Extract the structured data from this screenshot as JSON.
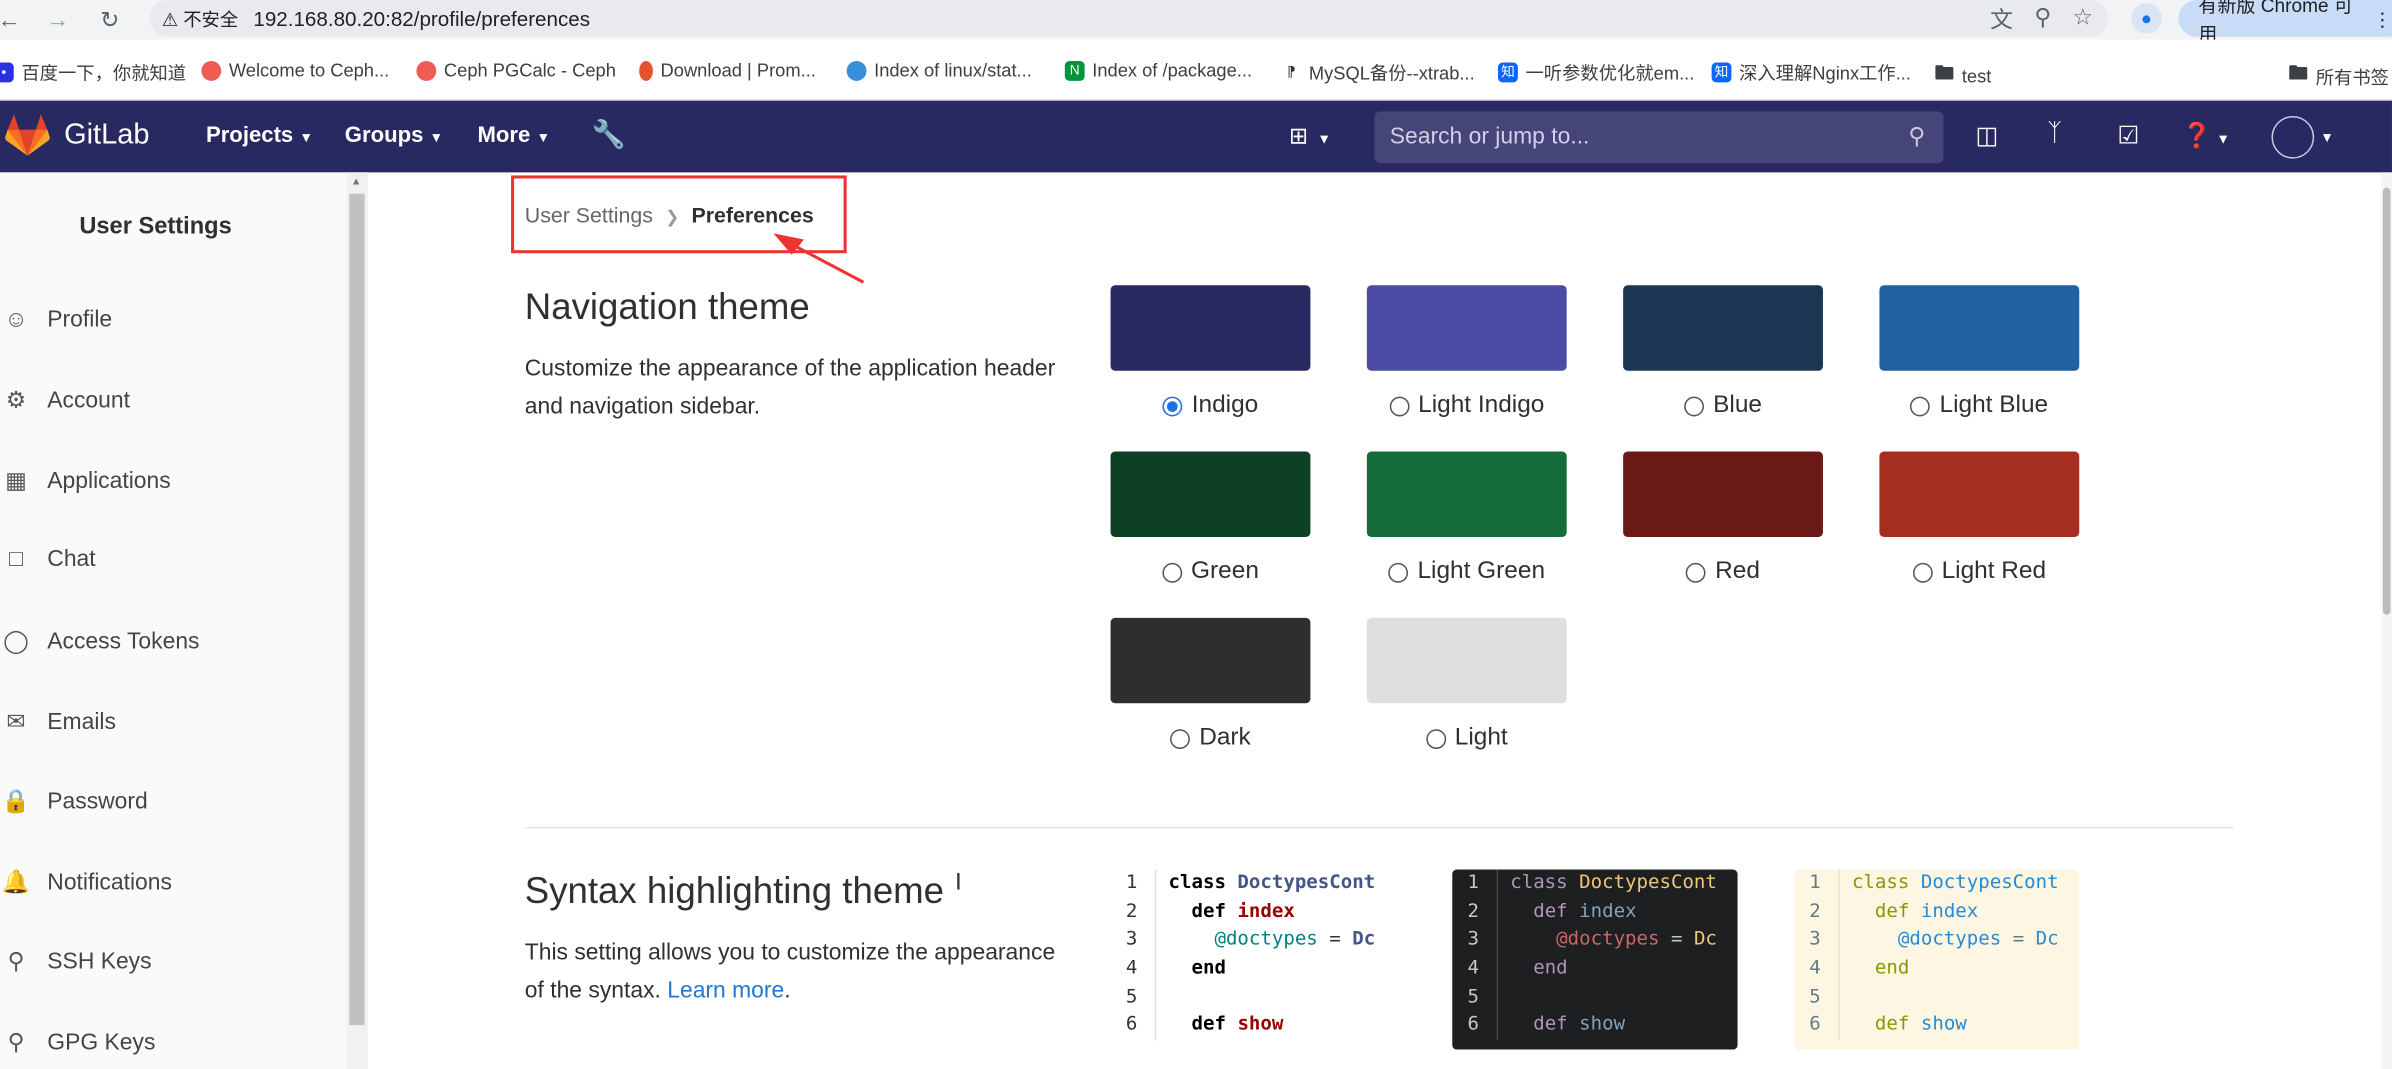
{
  "browser": {
    "warning": "不安全",
    "url": "192.168.80.20:82/profile/preferences",
    "update_label": "有新版 Chrome 可用",
    "bookmarks": [
      {
        "label": "百度一下，你就知道"
      },
      {
        "label": "Welcome to Ceph..."
      },
      {
        "label": "Ceph PGCalc - Ceph"
      },
      {
        "label": "Download | Prom..."
      },
      {
        "label": "Index of linux/stat..."
      },
      {
        "label": "Index of /package..."
      },
      {
        "label": "MySQL备份--xtrab..."
      },
      {
        "label": "一听参数优化就em..."
      },
      {
        "label": "深入理解Nginx工作..."
      },
      {
        "label": "test"
      }
    ],
    "all_bookmarks": "所有书签"
  },
  "header": {
    "brand": "GitLab",
    "menus": [
      "Projects",
      "Groups",
      "More"
    ],
    "search_placeholder": "Search or jump to..."
  },
  "sidebar": {
    "title": "User Settings",
    "items": [
      {
        "label": "Profile",
        "icon": "user-circle-icon"
      },
      {
        "label": "Account",
        "icon": "account-gear-icon"
      },
      {
        "label": "Applications",
        "icon": "applications-grid-icon"
      },
      {
        "label": "Chat",
        "icon": "chat-bubble-icon"
      },
      {
        "label": "Access Tokens",
        "icon": "token-icon"
      },
      {
        "label": "Emails",
        "icon": "envelope-icon"
      },
      {
        "label": "Password",
        "icon": "lock-icon"
      },
      {
        "label": "Notifications",
        "icon": "bell-icon"
      },
      {
        "label": "SSH Keys",
        "icon": "key-icon"
      },
      {
        "label": "GPG Keys",
        "icon": "key-icon"
      }
    ]
  },
  "breadcrumb": {
    "parent": "User Settings",
    "current": "Preferences"
  },
  "nav_theme": {
    "title": "Navigation theme",
    "description": "Customize the appearance of the application header and navigation sidebar.",
    "themes": [
      {
        "name": "Indigo",
        "color": "#292961",
        "selected": true
      },
      {
        "name": "Light Indigo",
        "color": "#4b4ba3",
        "selected": false
      },
      {
        "name": "Blue",
        "color": "#1a3652",
        "selected": false
      },
      {
        "name": "Light Blue",
        "color": "#2261a1",
        "selected": false
      },
      {
        "name": "Green",
        "color": "#0d4024",
        "selected": false
      },
      {
        "name": "Light Green",
        "color": "#156b39",
        "selected": false
      },
      {
        "name": "Red",
        "color": "#691a16",
        "selected": false
      },
      {
        "name": "Light Red",
        "color": "#a62e21",
        "selected": false
      },
      {
        "name": "Dark",
        "color": "#2e2e2e",
        "selected": false
      },
      {
        "name": "Light",
        "color": "#dfdfdf",
        "selected": false
      }
    ]
  },
  "syntax_theme": {
    "title": "Syntax highlighting theme",
    "description": "This setting allows you to customize the appearance of the syntax.",
    "learn_more": "Learn more",
    "code_lines": [
      {
        "n": "1",
        "parts": [
          [
            "kw",
            "class "
          ],
          [
            "cls",
            "DoctypesCont"
          ]
        ]
      },
      {
        "n": "2",
        "parts": [
          [
            "tx",
            "  "
          ],
          [
            "kw",
            "def "
          ],
          [
            "fn",
            "index"
          ]
        ]
      },
      {
        "n": "3",
        "parts": [
          [
            "tx",
            "    "
          ],
          [
            "iv",
            "@doctypes"
          ],
          [
            "tx",
            " = "
          ],
          [
            "cls",
            "Dc"
          ]
        ]
      },
      {
        "n": "4",
        "parts": [
          [
            "tx",
            "  "
          ],
          [
            "kw",
            "end"
          ]
        ]
      },
      {
        "n": "5",
        "parts": []
      },
      {
        "n": "6",
        "parts": [
          [
            "tx",
            "  "
          ],
          [
            "kw",
            "def "
          ],
          [
            "fn",
            "show"
          ]
        ]
      }
    ]
  }
}
